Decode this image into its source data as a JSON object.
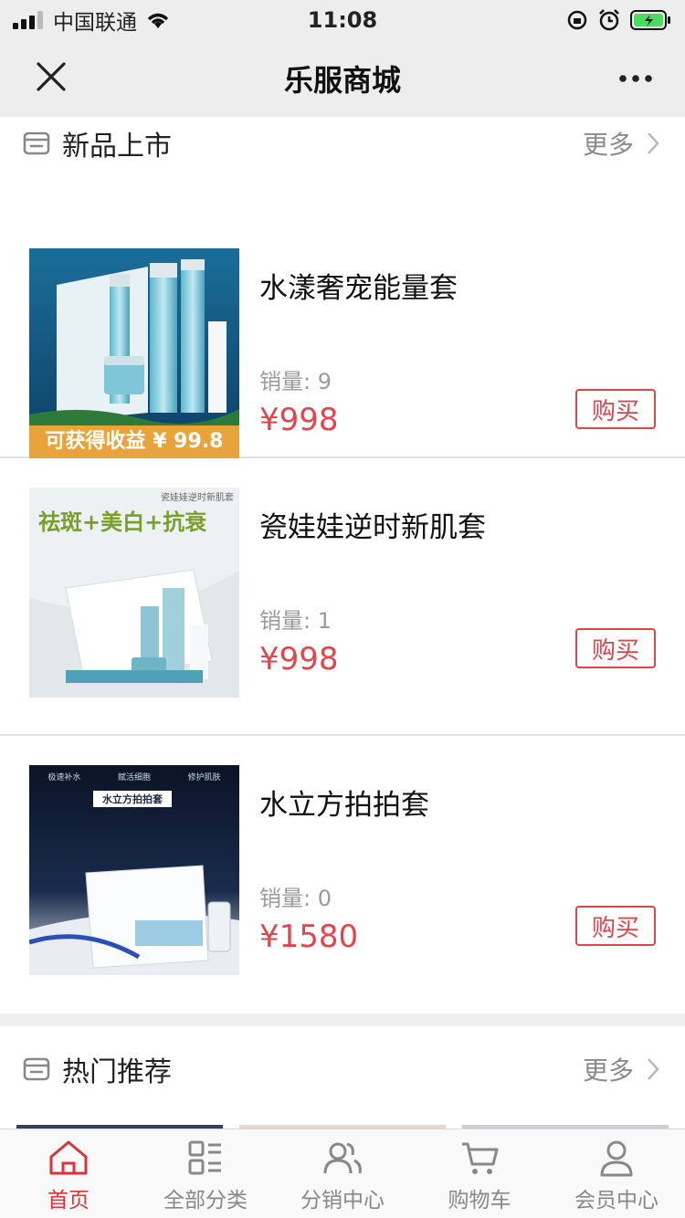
{
  "status": {
    "carrier": "中国联通",
    "time": "11:08"
  },
  "nav": {
    "title": "乐服商城"
  },
  "new_arrivals": {
    "title": "新品上市",
    "more": "更多",
    "items": [
      {
        "name": "水漾奢宠能量套",
        "sales": "销量: 9",
        "price": "¥998",
        "buy": "购买",
        "earn": "可获得收益 ¥ 99.8"
      },
      {
        "name": "瓷娃娃逆时新肌套",
        "sales": "销量: 1",
        "price": "¥998",
        "buy": "购买",
        "thumb_headline": "祛斑+美白+抗衰",
        "thumb_caption": "瓷娃娃逆时新肌套"
      },
      {
        "name": "水立方拍拍套",
        "sales": "销量: 0",
        "price": "¥1580",
        "buy": "购买",
        "thumb_tag": "水立方拍拍套",
        "thumb_features": [
          "极速补水",
          "赋活细胞",
          "修护肌肤"
        ]
      }
    ]
  },
  "hot": {
    "title": "热门推荐",
    "more": "更多"
  },
  "tabbar": {
    "items": [
      {
        "label": "首页",
        "icon": "home-icon",
        "active": true
      },
      {
        "label": "全部分类",
        "icon": "category-icon",
        "active": false
      },
      {
        "label": "分销中心",
        "icon": "users-icon",
        "active": false
      },
      {
        "label": "购物车",
        "icon": "cart-icon",
        "active": false
      },
      {
        "label": "会员中心",
        "icon": "user-icon",
        "active": false
      }
    ]
  },
  "colors": {
    "accent": "#d9343a",
    "price": "#e0464b",
    "earn_banner": "#e8a43a"
  }
}
